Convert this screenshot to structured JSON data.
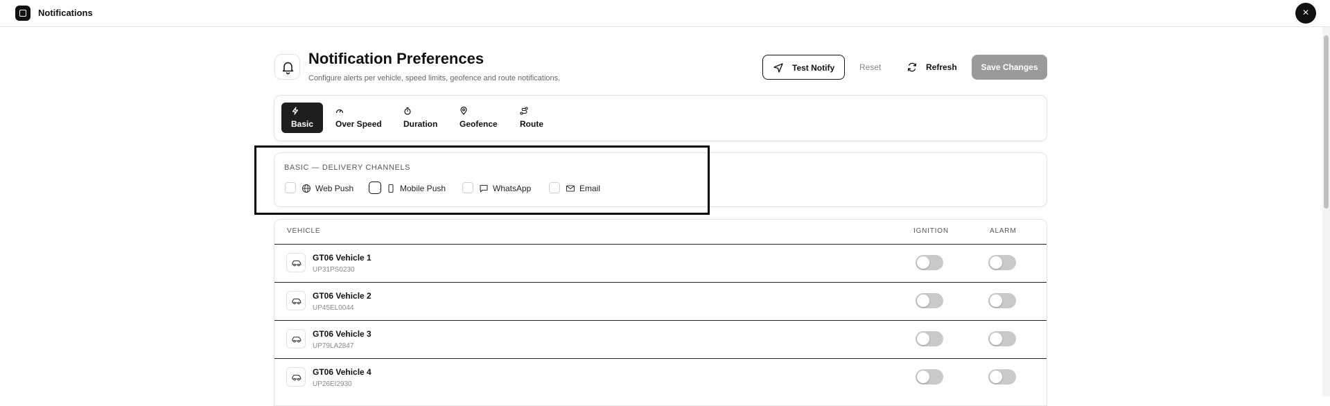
{
  "topbar": {
    "title": "Notifications",
    "close_symbol": "×"
  },
  "header": {
    "title": "Notification Preferences",
    "subtitle": "Configure alerts per vehicle, speed limits, geofence and route notifications.",
    "test_notify": "Test Notify",
    "reset": "Reset",
    "refresh": "Refresh",
    "save": "Save Changes"
  },
  "tabs": [
    {
      "label": "Basic",
      "icon": "bolt-icon",
      "active": true
    },
    {
      "label": "Over Speed",
      "icon": "speedometer-icon",
      "active": false
    },
    {
      "label": "Duration",
      "icon": "stopwatch-icon",
      "active": false
    },
    {
      "label": "Geofence",
      "icon": "map-pin-icon",
      "active": false
    },
    {
      "label": "Route",
      "icon": "route-icon",
      "active": false
    }
  ],
  "channels": {
    "title": "BASIC — DELIVERY CHANNELS",
    "items": [
      {
        "label": "Web Push",
        "icon": "globe-icon",
        "checked": false
      },
      {
        "label": "Mobile Push",
        "icon": "phone-icon",
        "checked": false
      },
      {
        "label": "WhatsApp",
        "icon": "chat-icon",
        "checked": false
      },
      {
        "label": "Email",
        "icon": "mail-icon",
        "checked": false
      }
    ]
  },
  "table": {
    "columns": [
      "VEHICLE",
      "IGNITION",
      "ALARM"
    ],
    "rows": [
      {
        "name": "GT06 Vehicle 1",
        "plate": "UP31PS0230",
        "ignition": false,
        "alarm": false
      },
      {
        "name": "GT06 Vehicle 2",
        "plate": "UP45EL0044",
        "ignition": false,
        "alarm": false
      },
      {
        "name": "GT06 Vehicle 3",
        "plate": "UP79LA2847",
        "ignition": false,
        "alarm": false
      },
      {
        "name": "GT06 Vehicle 4",
        "plate": "UP26EI2930",
        "ignition": false,
        "alarm": false
      }
    ]
  },
  "colors": {
    "accent": "#1e1e1e",
    "save_disabled": "#9a9a9a",
    "toggle_off": "#c9c9c9"
  }
}
